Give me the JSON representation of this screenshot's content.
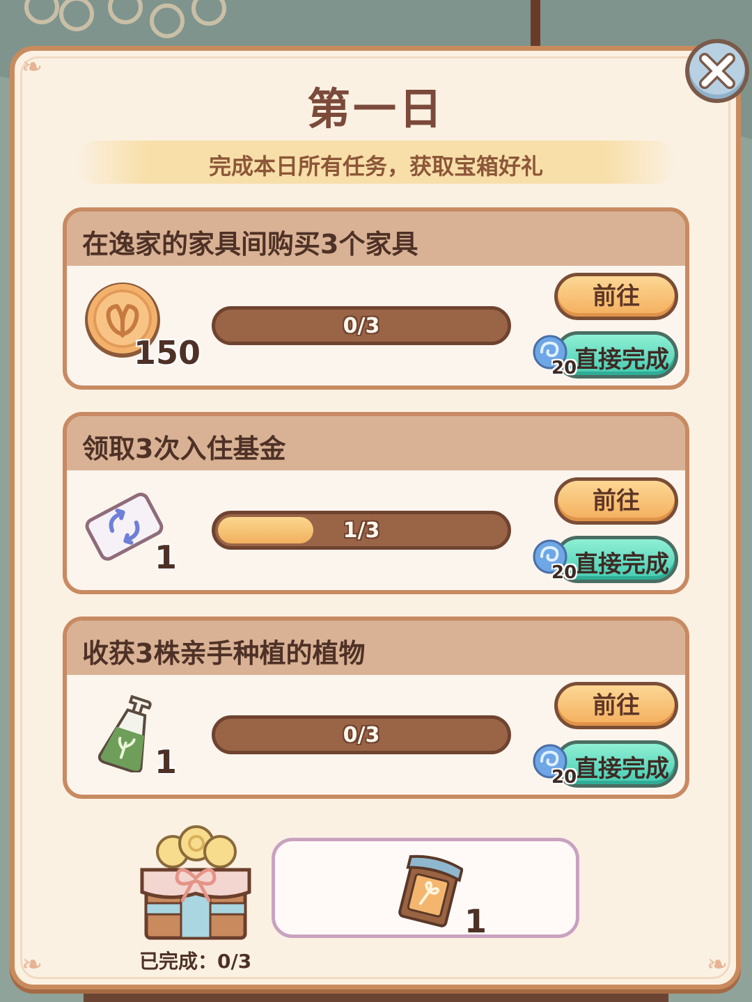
{
  "dialog": {
    "title": "第一日",
    "subtitle": "完成本日所有任务，获取宝箱好礼",
    "close_icon": "close-icon"
  },
  "tasks": [
    {
      "title": "在逸家的家具间购买3个家具",
      "reward_icon": "leaf-coin-icon",
      "reward_count": "150",
      "progress_text": "0/3",
      "progress_value": 0,
      "progress_max": 3,
      "go_label": "前往",
      "finish_label": "直接完成",
      "finish_cost": "20",
      "finish_cost_icon": "blue-gem-icon"
    },
    {
      "title": "领取3次入住基金",
      "reward_icon": "refresh-ticket-icon",
      "reward_count": "1",
      "progress_text": "1/3",
      "progress_value": 1,
      "progress_max": 3,
      "go_label": "前往",
      "finish_label": "直接完成",
      "finish_cost": "20",
      "finish_cost_icon": "blue-gem-icon"
    },
    {
      "title": "收获3株亲手种植的植物",
      "reward_icon": "fertilizer-bottle-icon",
      "reward_count": "1",
      "progress_text": "0/3",
      "progress_value": 0,
      "progress_max": 3,
      "go_label": "前往",
      "finish_label": "直接完成",
      "finish_cost": "20",
      "finish_cost_icon": "blue-gem-icon"
    }
  ],
  "chest": {
    "icon": "gift-chest-icon",
    "status_text": "已完成：0/3"
  },
  "final_reward": {
    "icon": "scroll-card-icon",
    "count": "1"
  },
  "colors": {
    "panel_bg": "#fbf1e3",
    "panel_border": "#c98b5e",
    "title": "#7b4a3a",
    "go_button": "#f4ae5d",
    "finish_button": "#45cbb1",
    "progress_fill": "#f1b05f"
  }
}
